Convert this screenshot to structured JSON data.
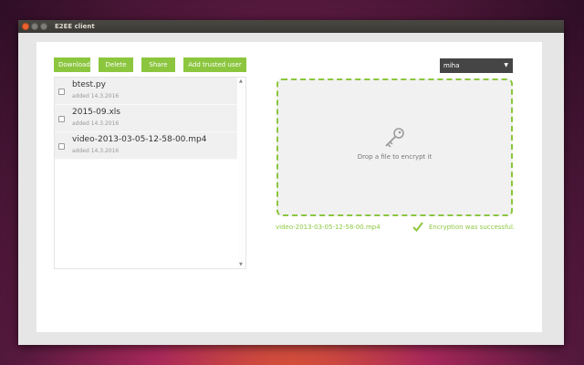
{
  "window": {
    "title": "E2EE client"
  },
  "toolbar": {
    "download_label": "Download",
    "delete_label": "Delete",
    "share_label": "Share",
    "add_trusted_user_label": "Add trusted user"
  },
  "files": [
    {
      "name": "btest.py",
      "date": "added 14.3.2016"
    },
    {
      "name": "2015-09.xls",
      "date": "added 14.3.2016"
    },
    {
      "name": "video-2013-03-05-12-58-00.mp4",
      "date": "added 14.3.2016"
    }
  ],
  "user_select": {
    "value": "miha"
  },
  "dropzone": {
    "text": "Drop a file to encrypt it"
  },
  "status": {
    "filename": "video-2013-03-05-12-58-00.mp4",
    "message": "Encryption was successful."
  },
  "colors": {
    "accent": "#8cc63f",
    "select_bg": "#454545"
  }
}
